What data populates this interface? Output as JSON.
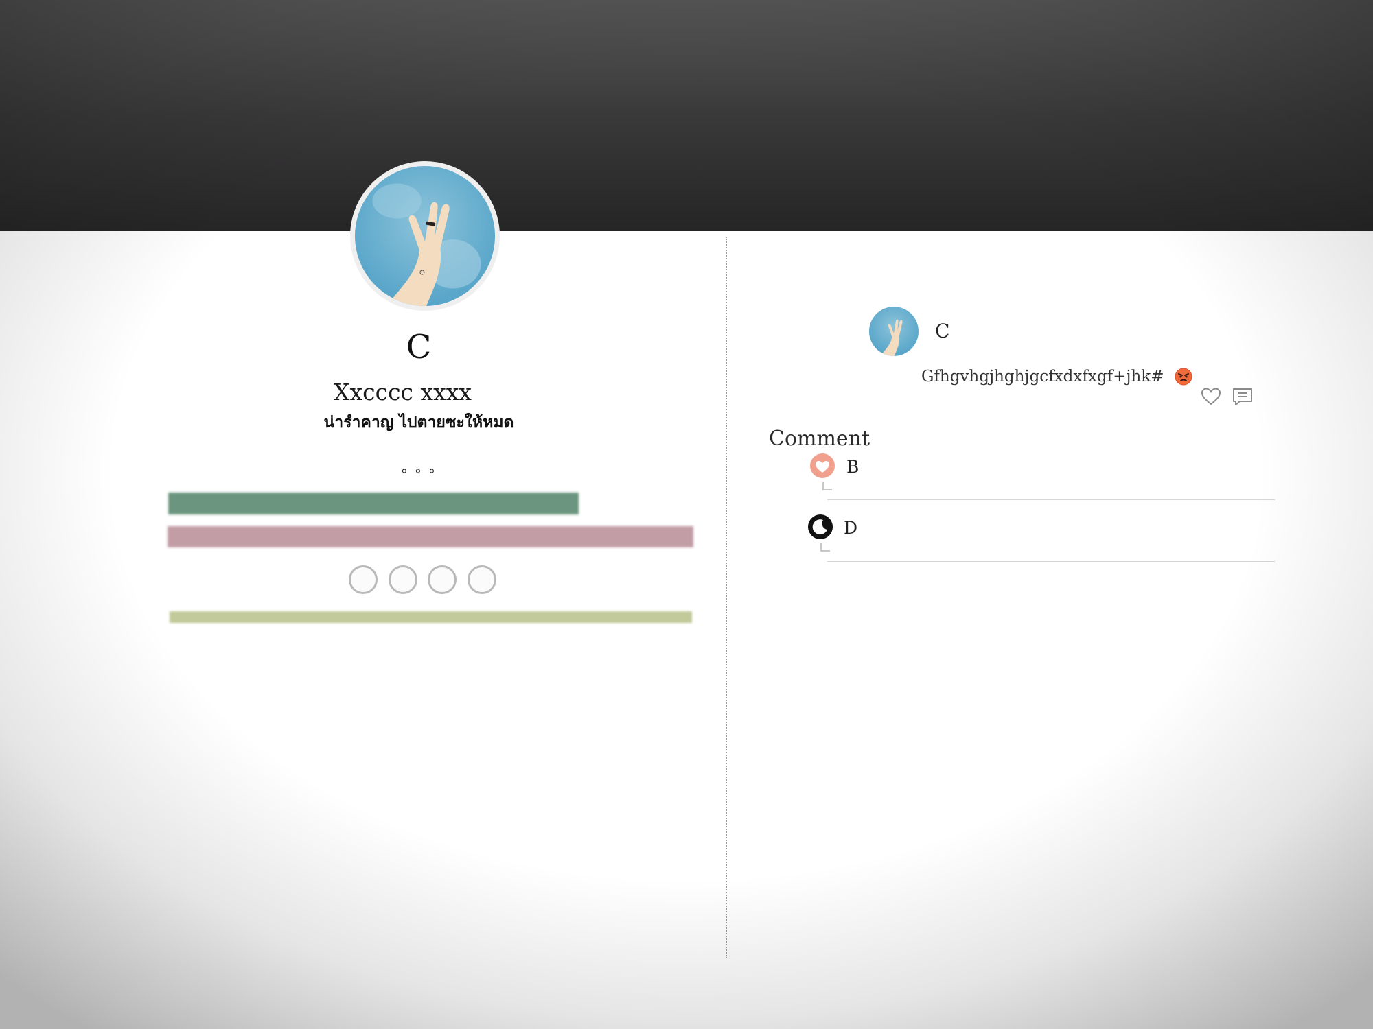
{
  "profile": {
    "name": "C",
    "handle": "Xxcccc xxxx",
    "bio": "น่ารำคาญ ไปตายซะให้หมด",
    "dots": "。。。",
    "avatar_icon": "hand-peace-sign-avatar",
    "social_icons": [
      "social-circle-1",
      "social-circle-2",
      "social-circle-3",
      "social-circle-4"
    ],
    "bar_colors": {
      "green": "#6b957e",
      "pink": "#c29da6",
      "olive": "#c2c99a"
    }
  },
  "post": {
    "author": "C",
    "text": "Gfhgvhgjhghjgcfxdxfxgf+jhk#",
    "emoji": "angry-face-emoji",
    "actions": [
      "heart-icon",
      "comment-icon"
    ]
  },
  "comments": {
    "heading": "Comment",
    "items": [
      {
        "name": "B",
        "avatar": "heart-avatar-icon",
        "color": "#f0a08c"
      },
      {
        "name": "D",
        "avatar": "moon-avatar-icon",
        "color": "#111111"
      }
    ]
  }
}
